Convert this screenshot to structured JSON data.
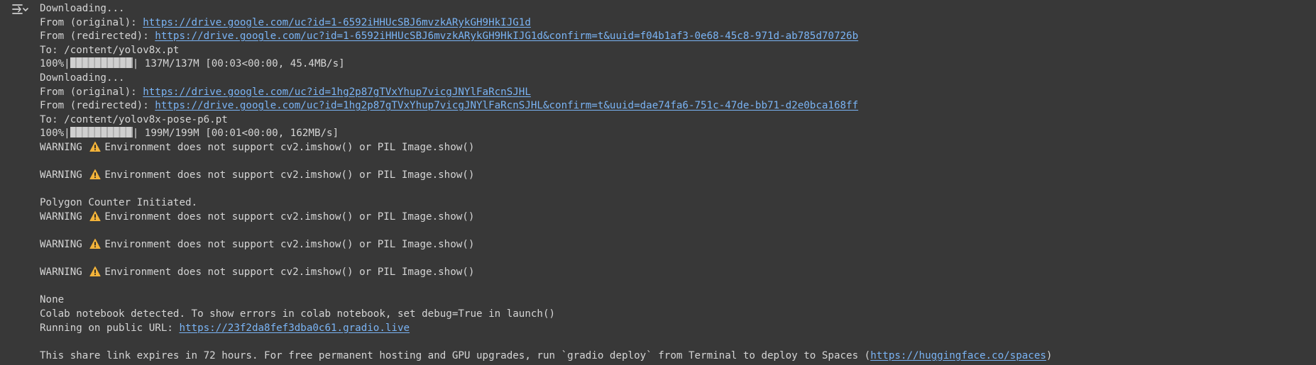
{
  "output": {
    "lines": [
      {
        "type": "text",
        "text": "Downloading..."
      },
      {
        "type": "link",
        "prefix": "From (original): ",
        "url": "https://drive.google.com/uc?id=1-6592iHHUcSBJ6mvzkARykGH9HkIJG1d"
      },
      {
        "type": "link",
        "prefix": "From (redirected): ",
        "url": "https://drive.google.com/uc?id=1-6592iHHUcSBJ6mvzkARykGH9HkIJG1d&confirm=t&uuid=f04b1af3-0e68-45c8-971d-ab785d70726b"
      },
      {
        "type": "text",
        "text": "To: /content/yolov8x.pt"
      },
      {
        "type": "progress",
        "prefix": "100%|",
        "suffix": "| 137M/137M [00:03<00:00, 45.4MB/s]",
        "fraction": 1.0
      },
      {
        "type": "text",
        "text": "Downloading..."
      },
      {
        "type": "link",
        "prefix": "From (original): ",
        "url": "https://drive.google.com/uc?id=1hg2p87gTVxYhup7vicgJNYlFaRcnSJHL"
      },
      {
        "type": "link",
        "prefix": "From (redirected): ",
        "url": "https://drive.google.com/uc?id=1hg2p87gTVxYhup7vicgJNYlFaRcnSJHL&confirm=t&uuid=dae74fa6-751c-47de-bb71-d2e0bca168ff"
      },
      {
        "type": "text",
        "text": "To: /content/yolov8x-pose-p6.pt"
      },
      {
        "type": "progress",
        "prefix": "100%|",
        "suffix": "| 199M/199M [00:01<00:00, 162MB/s]",
        "fraction": 1.0
      },
      {
        "type": "warning",
        "prefix": "WARNING",
        "text": "Environment does not support cv2.imshow() or PIL Image.show()"
      },
      {
        "type": "blank"
      },
      {
        "type": "warning",
        "prefix": "WARNING",
        "text": "Environment does not support cv2.imshow() or PIL Image.show()"
      },
      {
        "type": "blank"
      },
      {
        "type": "text",
        "text": "Polygon Counter Initiated."
      },
      {
        "type": "warning",
        "prefix": "WARNING",
        "text": "Environment does not support cv2.imshow() or PIL Image.show()"
      },
      {
        "type": "blank"
      },
      {
        "type": "warning",
        "prefix": "WARNING",
        "text": "Environment does not support cv2.imshow() or PIL Image.show()"
      },
      {
        "type": "blank"
      },
      {
        "type": "warning",
        "prefix": "WARNING",
        "text": "Environment does not support cv2.imshow() or PIL Image.show()"
      },
      {
        "type": "blank"
      },
      {
        "type": "text",
        "text": "None"
      },
      {
        "type": "text",
        "text": "Colab notebook detected. To show errors in colab notebook, set debug=True in launch()"
      },
      {
        "type": "link",
        "prefix": "Running on public URL: ",
        "url": "https://23f2da8fef3dba0c61.gradio.live"
      },
      {
        "type": "blank"
      },
      {
        "type": "link",
        "prefix": "This share link expires in 72 hours. For free permanent hosting and GPU upgrades, run `gradio deploy` from Terminal to deploy to Spaces (",
        "url": "https://huggingface.co/spaces",
        "suffix": ")"
      }
    ]
  },
  "icons": {
    "toggle": "output-collapse-icon",
    "warning": "warning-icon"
  },
  "colors": {
    "background": "#383838",
    "text": "#d5d5d5",
    "link": "#7ab4f5",
    "warning": "#f3b33a"
  }
}
